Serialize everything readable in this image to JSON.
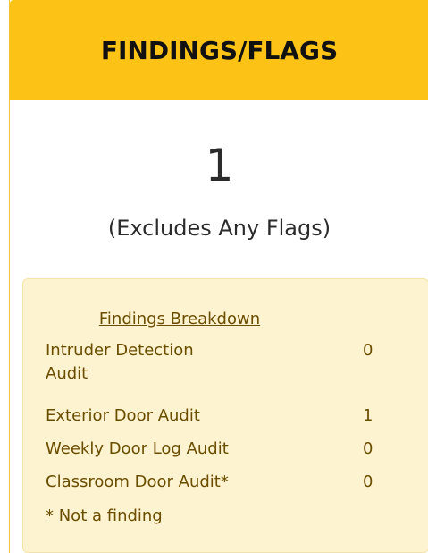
{
  "header": {
    "title": "FINDINGS/FLAGS"
  },
  "summary": {
    "count": "1",
    "note": "(Excludes Any Flags)"
  },
  "breakdown": {
    "title": "Findings Breakdown",
    "rows": [
      {
        "label": "Intruder Detection",
        "label2": "Audit",
        "value": "0"
      },
      {
        "label": "Exterior Door Audit",
        "value": "1"
      },
      {
        "label": "Weekly Door Log Audit",
        "value": "0"
      },
      {
        "label": "Classroom Door Audit*",
        "value": "0"
      }
    ],
    "footnote": "* Not a finding"
  },
  "colors": {
    "header_bg": "#fcc316",
    "breakdown_bg": "#fdf3d0",
    "breakdown_text": "#6b4d00"
  }
}
